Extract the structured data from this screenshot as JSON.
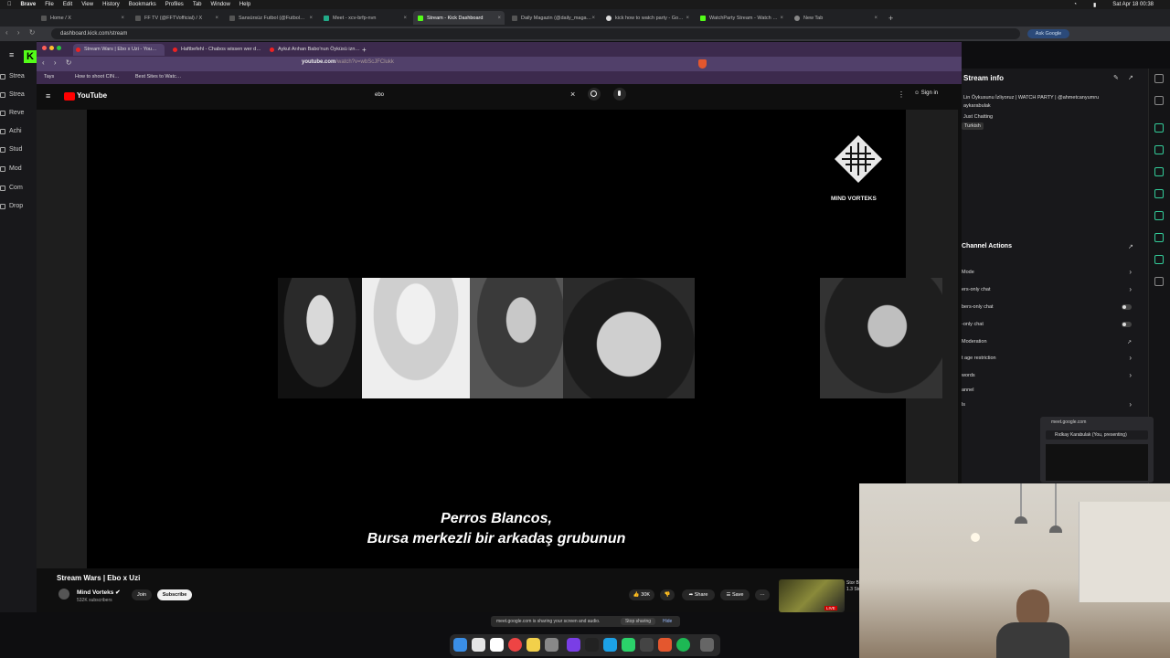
{
  "menubar": {
    "app": "Brave",
    "items": [
      "File",
      "Edit",
      "View",
      "History",
      "Bookmarks",
      "Profiles",
      "Tab",
      "Window",
      "Help"
    ],
    "clock": "Sat Apr 18 00:38"
  },
  "outer_tabs": [
    {
      "label": "Home / X"
    },
    {
      "label": "FF TV (@FFTVofficial) / X"
    },
    {
      "label": "Sansürsüz Futbol (@Futbol…"
    },
    {
      "label": "Meet - xcv-brfp-nvn"
    },
    {
      "label": "Stream - Kick Dashboard"
    },
    {
      "label": "Daily Magazin (@daily_maga…"
    },
    {
      "label": "kick how to watch party - Go…"
    },
    {
      "label": "WatchParty Stream - Watch …"
    },
    {
      "label": "New Tab"
    }
  ],
  "outer_url": "dashboard.kick.com/stream",
  "ask_google": "Ask Google",
  "kick_sidebar": {
    "logo": "K",
    "items": [
      "Strea",
      "Strea",
      "Reve",
      "Achi",
      "Stud",
      "Mod",
      "Com",
      "Drop"
    ]
  },
  "inner_tabs": [
    {
      "label": "Stream Wars | Ebo x Uzi - You…"
    },
    {
      "label": "Haftbefehl - Chabos wissen wer d…"
    },
    {
      "label": "Aykut Arıhan Babo'nun Öyküsü izn…"
    }
  ],
  "inner_url": {
    "host": "youtube.com",
    "path": "/watch?v=wbScJFClukk"
  },
  "bookmarks": [
    "Tays",
    "How to shoot CIN…",
    "Best Sites to Watc…"
  ],
  "youtube": {
    "brand": "YouTube",
    "search_value": "ebo",
    "sign_in": "Sign in",
    "video_watermark": "MIND VORTEKS",
    "subtitle_line1": "Perros Blancos,",
    "subtitle_line2": "Bursa merkezli bir arkadaş grubunun",
    "video_title": "Stream Wars | Ebo x Uzi",
    "channel_name": "Mind Vorteks",
    "channel_subs": "532K subscribers",
    "join": "Join",
    "subscribe": "Subscribe",
    "likes": "30K",
    "share": "Share",
    "save": "Save",
    "related_text": "Stor Bad 1.3 Stud",
    "related_live": "LIVE"
  },
  "right_panel": {
    "stream_info_title": "Stream info",
    "stream_title_line1": "Lin Öykusunu İzliyoruz | WATCH PARTY | @ahmetcanyumru",
    "stream_title_line2": "aykarabulak",
    "category": "Just Chatting",
    "language": "Turkish",
    "channel_actions_title": "Channel Actions",
    "actions": [
      {
        "label": "Mode",
        "control": "chevron"
      },
      {
        "label": "ers-only chat",
        "control": "chevron"
      },
      {
        "label": "bers-only chat",
        "control": "toggle"
      },
      {
        "label": "-only chat",
        "control": "toggle"
      },
      {
        "label": "Moderation",
        "control": "external"
      },
      {
        "label": "t age restriction",
        "control": "chevron"
      },
      {
        "label": "words",
        "control": "chevron"
      },
      {
        "label": "annel",
        "control": "none"
      },
      {
        "label": "ls",
        "control": "chevron"
      }
    ]
  },
  "meet_mini": {
    "host": "meet.google.com",
    "presenter": "Rıdkay Karabulak (You, presenting)"
  },
  "share_bar": {
    "message": "meet.google.com is sharing your screen and audio.",
    "stop": "Stop sharing",
    "hide": "Hide"
  },
  "colors": {
    "kick_green": "#53fc18",
    "youtube_red": "#ff0000",
    "inner_browser_purple": "#3c2a4d"
  }
}
